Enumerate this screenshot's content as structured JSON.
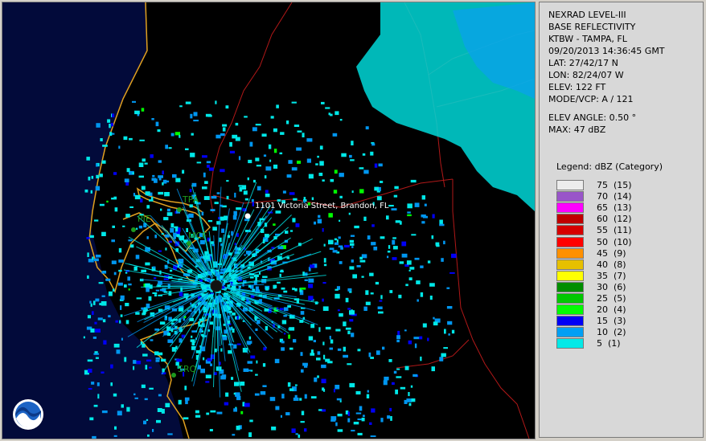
{
  "map": {
    "cities": [
      {
        "label": "TPA"
      },
      {
        "label": "PIE"
      },
      {
        "label": "MCF"
      },
      {
        "label": "SRQ"
      }
    ],
    "address_label": "1101 Victoria Street, Brandon, FL",
    "logo_text": "NOAA",
    "colors": {
      "water": "#020a3a",
      "land": "#000000",
      "coast": "#e0a020",
      "roads": "#b01818",
      "echo_5": "#00e8e8",
      "echo_10": "#0096f0",
      "echo_15": "#0000f6",
      "echo_20": "#00ff00"
    }
  },
  "info": {
    "title": "NEXRAD LEVEL-III",
    "product": "BASE REFLECTIVITY",
    "station": "KTBW - TAMPA, FL",
    "datetime": "09/20/2013 14:36:45 GMT",
    "lat": "LAT: 27/42/17 N",
    "lon": "LON: 82/24/07 W",
    "elev": "ELEV: 122 FT",
    "mode": "MODE/VCP: A / 121",
    "elev_angle": "ELEV ANGLE: 0.50 °",
    "max": "MAX: 47 dBZ"
  },
  "legend": {
    "title": "Legend: dBZ (Category)",
    "items": [
      {
        "label": "75  (15)",
        "color": "#ececec"
      },
      {
        "label": "70  (14)",
        "color": "#9955c9"
      },
      {
        "label": "65  (13)",
        "color": "#ff00ff"
      },
      {
        "label": "60  (12)",
        "color": "#c00000"
      },
      {
        "label": "55  (11)",
        "color": "#d60000"
      },
      {
        "label": "50  (10)",
        "color": "#ff0000"
      },
      {
        "label": "45  (9)",
        "color": "#ff9000"
      },
      {
        "label": "40  (8)",
        "color": "#e7c000"
      },
      {
        "label": "35  (7)",
        "color": "#ffff00"
      },
      {
        "label": "30  (6)",
        "color": "#008e00"
      },
      {
        "label": "25  (5)",
        "color": "#01c801"
      },
      {
        "label": "20  (4)",
        "color": "#02fd02"
      },
      {
        "label": "15  (3)",
        "color": "#0000f6"
      },
      {
        "label": "10  (2)",
        "color": "#019ff4"
      },
      {
        "label": "5  (1)",
        "color": "#04e9e7"
      }
    ]
  }
}
